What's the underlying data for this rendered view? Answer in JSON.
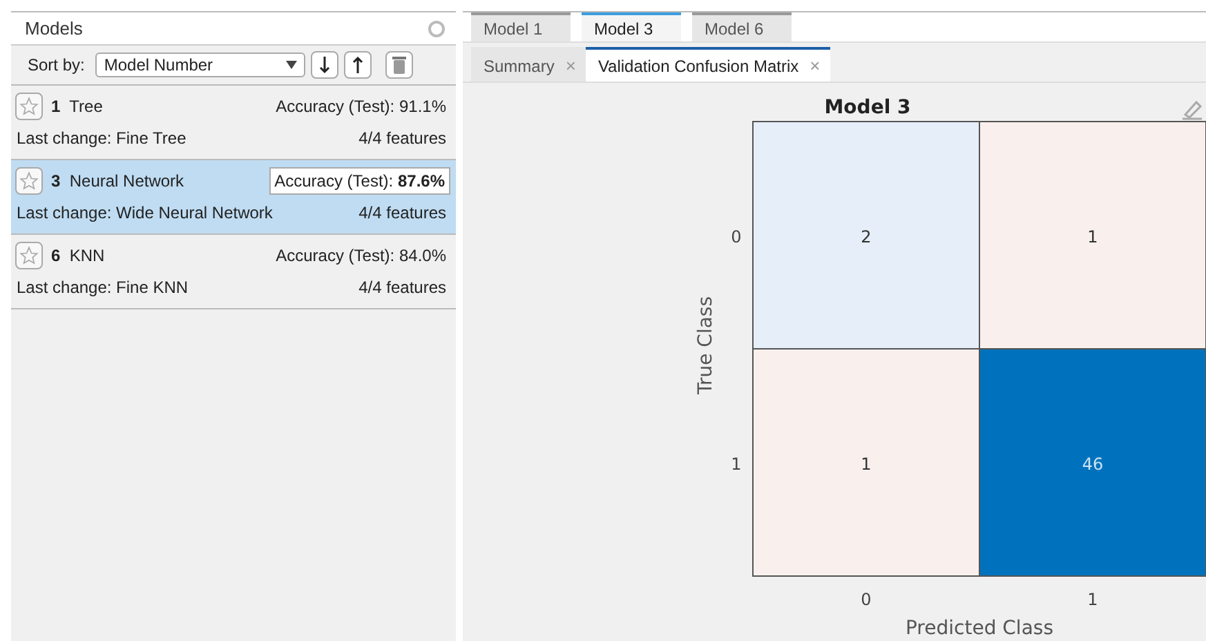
{
  "panel": {
    "title": "Models"
  },
  "sort": {
    "label": "Sort by:",
    "value": "Model Number"
  },
  "models": [
    {
      "number": "1",
      "name": "Tree",
      "accuracy_label": "Accuracy (Test):",
      "accuracy": "91.1%",
      "last_change": "Last change: Fine Tree",
      "features": "4/4 features",
      "selected": false,
      "starred": false
    },
    {
      "number": "3",
      "name": "Neural Network",
      "accuracy_label": "Accuracy (Test):",
      "accuracy": "87.6%",
      "last_change": "Last change: Wide Neural Network",
      "features": "4/4 features",
      "selected": true,
      "starred": false
    },
    {
      "number": "6",
      "name": "KNN",
      "accuracy_label": "Accuracy (Test):",
      "accuracy": "84.0%",
      "last_change": "Last change: Fine KNN",
      "features": "4/4 features",
      "selected": false,
      "starred": false
    }
  ],
  "model_tabs": [
    {
      "label": "Model 1",
      "selected": false
    },
    {
      "label": "Model 3",
      "selected": true
    },
    {
      "label": "Model 6",
      "selected": false
    }
  ],
  "view_tabs": [
    {
      "label": "Summary",
      "selected": false,
      "close": "×"
    },
    {
      "label": "Validation Confusion Matrix",
      "selected": true,
      "close": "×"
    }
  ],
  "plot": {
    "title": "Model 3",
    "ylabel": "True Class",
    "xlabel": "Predicted Class",
    "row_labels": [
      "0",
      "1"
    ],
    "column_labels": [
      "0",
      "1"
    ],
    "cells": [
      [
        {
          "value": "2",
          "color": "#e6eff9"
        },
        {
          "value": "1",
          "color": "#f9f0ee"
        }
      ],
      [
        {
          "value": "1",
          "color": "#f9f0ee"
        },
        {
          "value": "46",
          "color": "#0072bd"
        }
      ]
    ]
  }
}
